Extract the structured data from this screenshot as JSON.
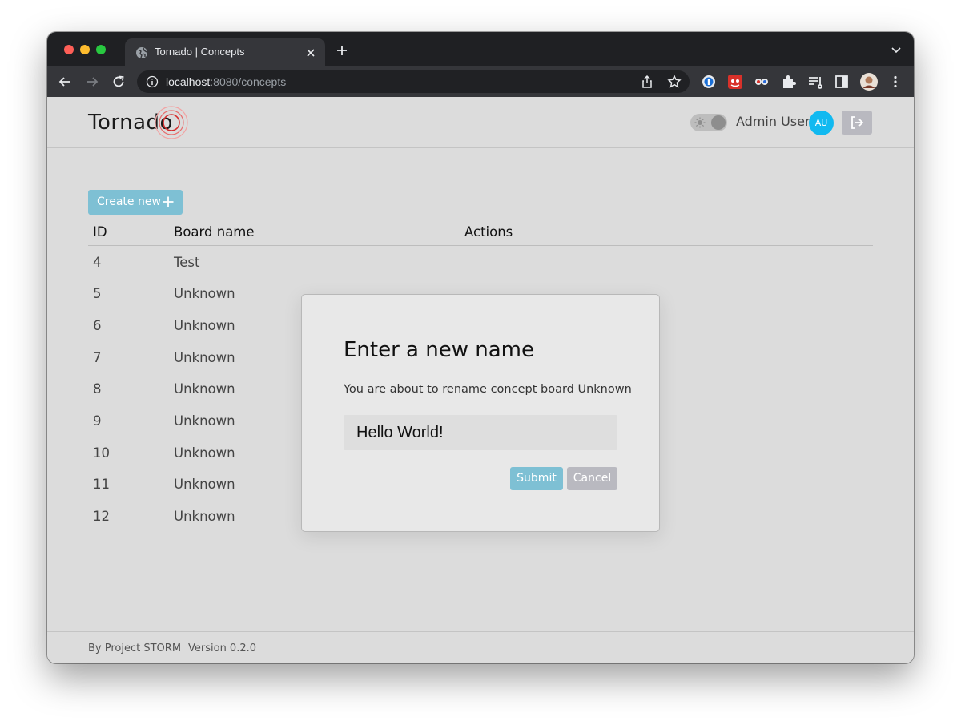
{
  "browser": {
    "tab_title": "Tornado | Concepts",
    "url_host": "localhost",
    "url_rest": ":8080/concepts"
  },
  "app": {
    "logo_text": "Tornado",
    "user_name": "Admin User",
    "avatar_initials": "AU",
    "accent_color": "#7ec0d4",
    "avatar_color": "#11b9f0"
  },
  "toolbar": {
    "create_label": "Create new"
  },
  "table": {
    "headers": {
      "id": "ID",
      "name": "Board name",
      "actions": "Actions"
    },
    "rows": [
      {
        "id": "4",
        "name": "Test"
      },
      {
        "id": "5",
        "name": "Unknown"
      },
      {
        "id": "6",
        "name": "Unknown"
      },
      {
        "id": "7",
        "name": "Unknown"
      },
      {
        "id": "8",
        "name": "Unknown"
      },
      {
        "id": "9",
        "name": "Unknown"
      },
      {
        "id": "10",
        "name": "Unknown"
      },
      {
        "id": "11",
        "name": "Unknown"
      },
      {
        "id": "12",
        "name": "Unknown"
      }
    ]
  },
  "dialog": {
    "title": "Enter a new name",
    "description": "You are about to rename concept board Unknown",
    "input_value": "Hello World!",
    "submit_label": "Submit",
    "cancel_label": "Cancel"
  },
  "footer": {
    "credit": "By Project STORM",
    "version": "Version 0.2.0"
  }
}
